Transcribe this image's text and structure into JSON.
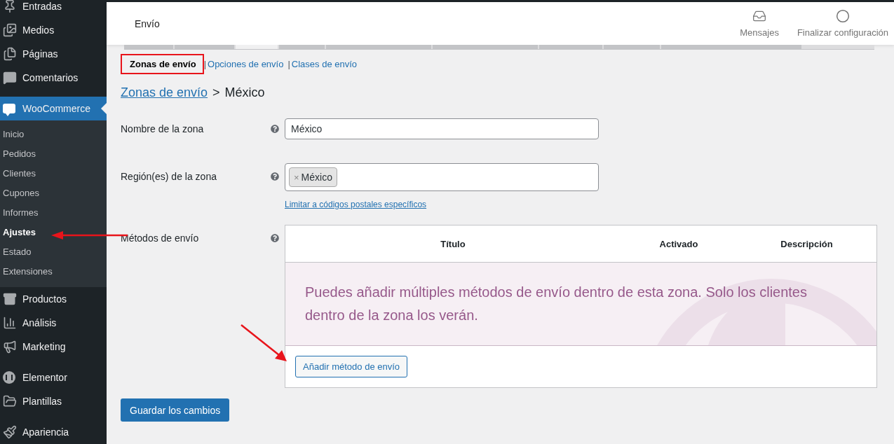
{
  "sidebar": {
    "items": [
      {
        "label": "Entradas",
        "selected": false
      },
      {
        "label": "Medios",
        "selected": false
      },
      {
        "label": "Páginas",
        "selected": false
      },
      {
        "label": "Comentarios",
        "selected": false
      },
      {
        "label": "WooCommerce",
        "selected": true,
        "children": [
          {
            "label": "Inicio",
            "selected": false
          },
          {
            "label": "Pedidos",
            "selected": false
          },
          {
            "label": "Clientes",
            "selected": false
          },
          {
            "label": "Cupones",
            "selected": false
          },
          {
            "label": "Informes",
            "selected": false
          },
          {
            "label": "Ajustes",
            "selected": true
          },
          {
            "label": "Estado",
            "selected": false
          },
          {
            "label": "Extensiones",
            "selected": false
          }
        ]
      },
      {
        "label": "Productos",
        "selected": false
      },
      {
        "label": "Análisis",
        "selected": false
      },
      {
        "label": "Marketing",
        "selected": false
      },
      {
        "label": "Elementor",
        "selected": false
      },
      {
        "label": "Plantillas",
        "selected": false
      },
      {
        "label": "Apariencia",
        "selected": false
      }
    ]
  },
  "header": {
    "title": "Envío",
    "actions": [
      {
        "label": "Mensajes"
      },
      {
        "label": "Finalizar configuración"
      }
    ]
  },
  "subnav": {
    "separator": "|",
    "items": [
      {
        "label": "Zonas de envío",
        "selected": true
      },
      {
        "label": "Opciones de envío",
        "selected": false
      },
      {
        "label": "Clases de envío",
        "selected": false
      }
    ]
  },
  "breadcrumb": {
    "link": "Zonas de envío",
    "separator": ">",
    "current": "México"
  },
  "zone_name": {
    "label": "Nombre de la zona",
    "value": "México"
  },
  "zone_regions": {
    "label": "Región(es) de la zona",
    "tags": [
      {
        "label": "México",
        "remove": "×"
      }
    ],
    "link": "Limitar a códigos postales específicos"
  },
  "shipping_methods": {
    "label": "Métodos de envío",
    "columns": [
      "Título",
      "Activado",
      "Descripción"
    ],
    "empty_message": "Puedes añadir múltiples métodos de envío dentro de esta zona. Solo los clientes dentro de la zona los verán.",
    "add_button": "Añadir método de envío"
  },
  "save_button": "Guardar los cambios"
}
